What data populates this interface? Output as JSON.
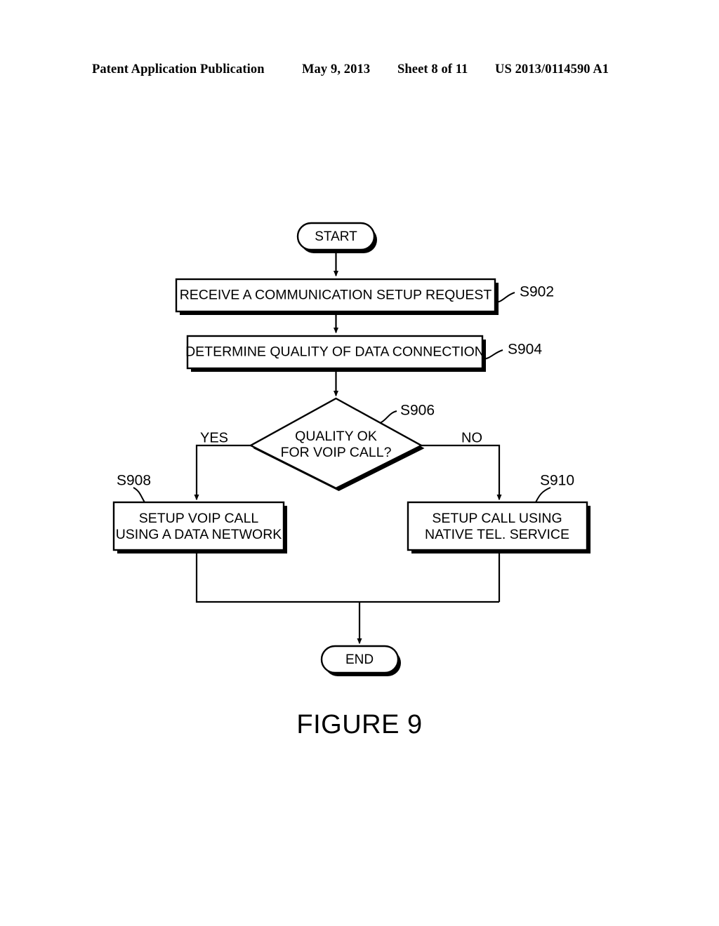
{
  "header": {
    "publication": "Patent Application Publication",
    "date": "May 9, 2013",
    "sheet": "Sheet 8 of 11",
    "doc_number": "US 2013/0114590 A1"
  },
  "figure": {
    "caption": "FIGURE 9"
  },
  "flowchart": {
    "start": {
      "label": "START"
    },
    "end": {
      "label": "END"
    },
    "steps": [
      {
        "ref": "S902",
        "label": "RECEIVE A COMMUNICATION SETUP REQUEST"
      },
      {
        "ref": "S904",
        "label": "DETERMINE QUALITY OF DATA CONNECTION"
      }
    ],
    "decision": {
      "ref": "S906",
      "line1": "QUALITY OK",
      "line2": "FOR VOIP CALL?",
      "yes_label": "YES",
      "no_label": "NO"
    },
    "outcomes": [
      {
        "ref": "S908",
        "line1": "SETUP VOIP CALL",
        "line2": "USING A DATA NETWORK"
      },
      {
        "ref": "S910",
        "line1": "SETUP CALL USING",
        "line2": "NATIVE TEL. SERVICE"
      }
    ]
  }
}
